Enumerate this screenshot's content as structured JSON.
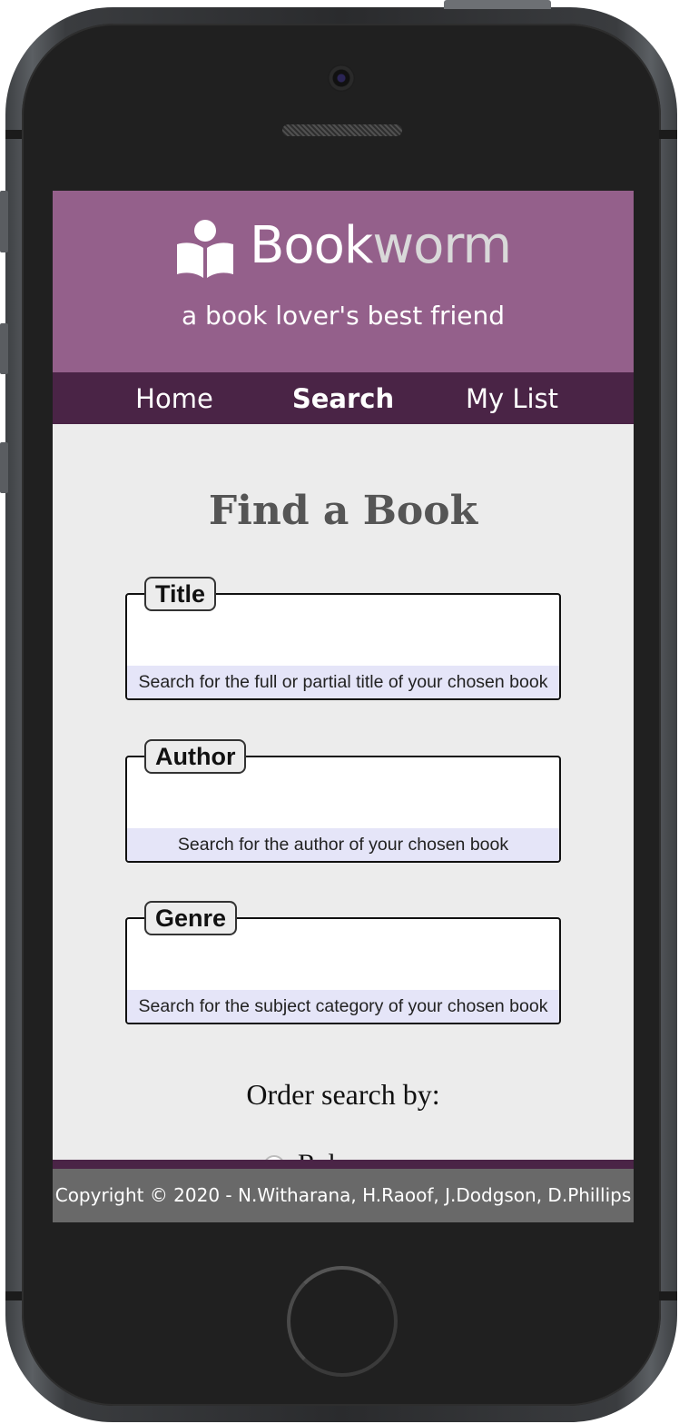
{
  "header": {
    "logo_primary": "Book",
    "logo_secondary": "worm",
    "tagline": "a book lover's best friend"
  },
  "nav": {
    "items": [
      {
        "label": "Home"
      },
      {
        "label": "Search"
      },
      {
        "label": "My List"
      }
    ],
    "active": "Search"
  },
  "main": {
    "title": "Find a Book",
    "fields": [
      {
        "legend": "Title",
        "value": "",
        "hint": "Search for the full or partial title of your chosen book"
      },
      {
        "legend": "Author",
        "value": "",
        "hint": "Search for the author of your chosen book"
      },
      {
        "legend": "Genre",
        "value": "",
        "hint": "Search for the subject category of your chosen book"
      }
    ],
    "order_label": "Order search by:",
    "order_option_partial": "Rel"
  },
  "footer": {
    "copyright": "Copyright © 2020 - N.Witharana, H.Raoof, J.Dodgson, D.Phillips"
  },
  "colors": {
    "header_bg": "#94608b",
    "nav_bg": "#4a2446",
    "content_bg": "#ececec",
    "hint_bg": "#e5e5f8",
    "footer_bg": "#696969"
  }
}
